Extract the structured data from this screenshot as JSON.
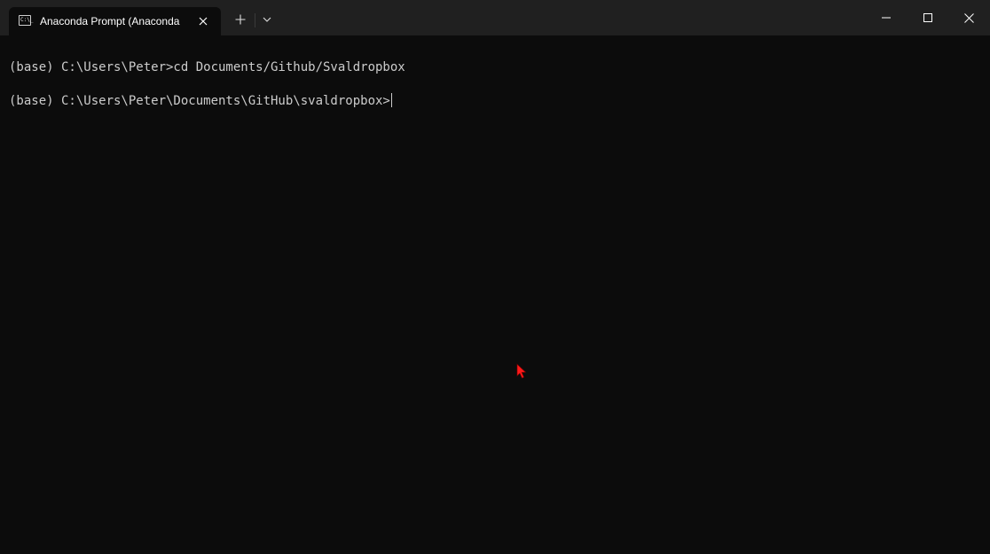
{
  "tab": {
    "title": "Anaconda Prompt (Anaconda",
    "icon": "command-prompt-icon",
    "icon_text": "C:\\_"
  },
  "titlebar": {
    "new_tab_icon": "plus-icon",
    "dropdown_icon": "chevron-down-icon",
    "minimize_icon": "minimize-icon",
    "maximize_icon": "maximize-icon",
    "close_icon": "close-icon"
  },
  "terminal": {
    "lines": [
      "(base) C:\\Users\\Peter>cd Documents/Github/Svaldropbox",
      "(base) C:\\Users\\Peter\\Documents\\GitHub\\svaldropbox>"
    ]
  },
  "colors": {
    "titlebar_bg": "#202020",
    "terminal_bg": "#0c0c0c",
    "text": "#cccccc",
    "pointer": "#ff0000"
  }
}
